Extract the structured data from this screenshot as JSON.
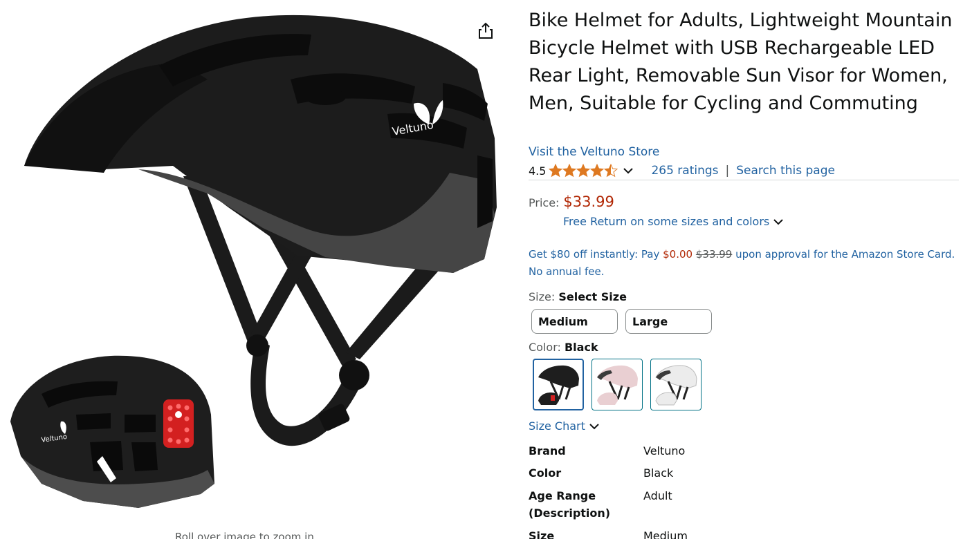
{
  "product": {
    "title": "Bike Helmet for Adults, Lightweight Mountain Bicycle Helmet with USB Rechargeable LED Rear Light, Removable Sun Visor for Women, Men, Suitable for Cycling and Commuting",
    "brand_logo_text": "Veltuno",
    "store_link": "Visit the Veltuno Store"
  },
  "image": {
    "zoom_hint": "Roll over image to zoom in",
    "share_icon": "share-icon"
  },
  "rating": {
    "value": "4.5",
    "stars": 4.5,
    "count_label": "265 ratings",
    "separator": "|",
    "search_label": "Search this page"
  },
  "price": {
    "label": "Price:",
    "value": "$33.99",
    "free_return": "Free Return on some sizes and colors"
  },
  "promo": {
    "part1": "Get $80 off instantly: Pay ",
    "pay_amount": "$0.00",
    "space": " ",
    "strike_amount": "$33.99",
    "part2": " upon approval for the Amazon Store Card. No annual fee."
  },
  "size": {
    "label": "Size:",
    "selected": "Select Size",
    "options": [
      "Medium",
      "Large"
    ]
  },
  "color": {
    "label": "Color:",
    "selected": "Black",
    "swatches": [
      {
        "name": "Black",
        "shell": "#1e1e1e",
        "band": "#4a4a4a"
      },
      {
        "name": "Pink",
        "shell": "#e9cfd2",
        "band": "#3a3a3a"
      },
      {
        "name": "White",
        "shell": "#ececec",
        "band": "#9a9a9a"
      }
    ]
  },
  "size_chart": {
    "label": "Size Chart"
  },
  "specs": [
    {
      "key": "Brand",
      "value": "Veltuno"
    },
    {
      "key": "Color",
      "value": "Black"
    },
    {
      "key": "Age Range (Description)",
      "value": "Adult"
    },
    {
      "key": "Size",
      "value": "Medium"
    }
  ],
  "colors": {
    "link": "#2162a1",
    "price": "#b12704",
    "star": "#de7921"
  }
}
